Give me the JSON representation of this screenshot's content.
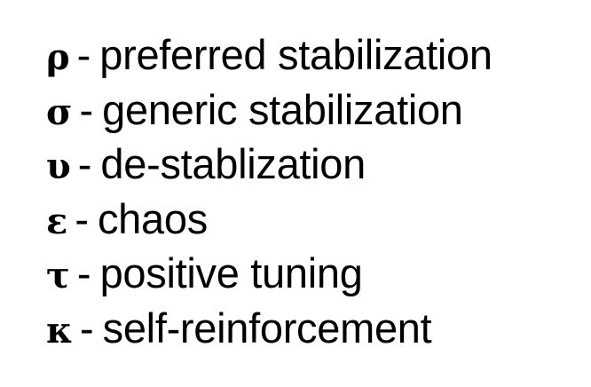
{
  "separator": "-",
  "items": [
    {
      "symbol": "ρ",
      "label": "preferred stabilization"
    },
    {
      "symbol": "σ",
      "label": "generic stabilization"
    },
    {
      "symbol": "υ",
      "label": "de-stablization"
    },
    {
      "symbol": "ε",
      "label": "chaos"
    },
    {
      "symbol": "τ",
      "label": "positive tuning"
    },
    {
      "symbol": "κ",
      "label": "self-reinforcement"
    }
  ]
}
